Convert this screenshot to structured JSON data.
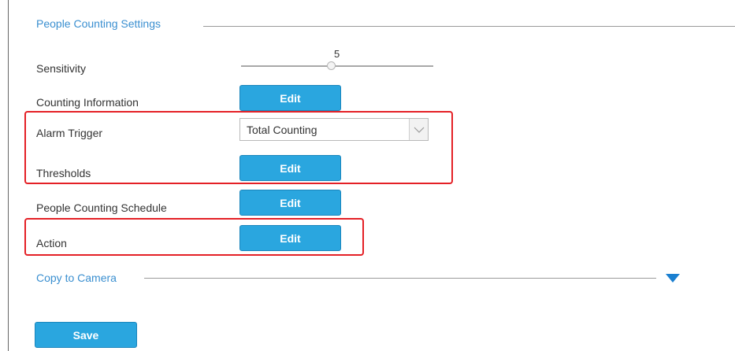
{
  "settings": {
    "title": "People Counting Settings",
    "sensitivity": {
      "label": "Sensitivity",
      "value": "5",
      "level_fraction": 0.46
    },
    "counting_information": {
      "label": "Counting Information",
      "button_label": "Edit"
    },
    "alarm_trigger": {
      "label": "Alarm Trigger",
      "selected": "Total Counting"
    },
    "thresholds": {
      "label": "Thresholds",
      "button_label": "Edit"
    },
    "schedule": {
      "label": "People Counting Schedule",
      "button_label": "Edit"
    },
    "action": {
      "label": "Action",
      "button_label": "Edit"
    }
  },
  "copy_to_camera": {
    "title": "Copy to Camera",
    "toggle_icon": "triangle-down-icon"
  },
  "footer": {
    "save_label": "Save"
  },
  "colors": {
    "accent": "#2aa6df",
    "section_title": "#3a8fd0",
    "highlight": "#e42026"
  }
}
